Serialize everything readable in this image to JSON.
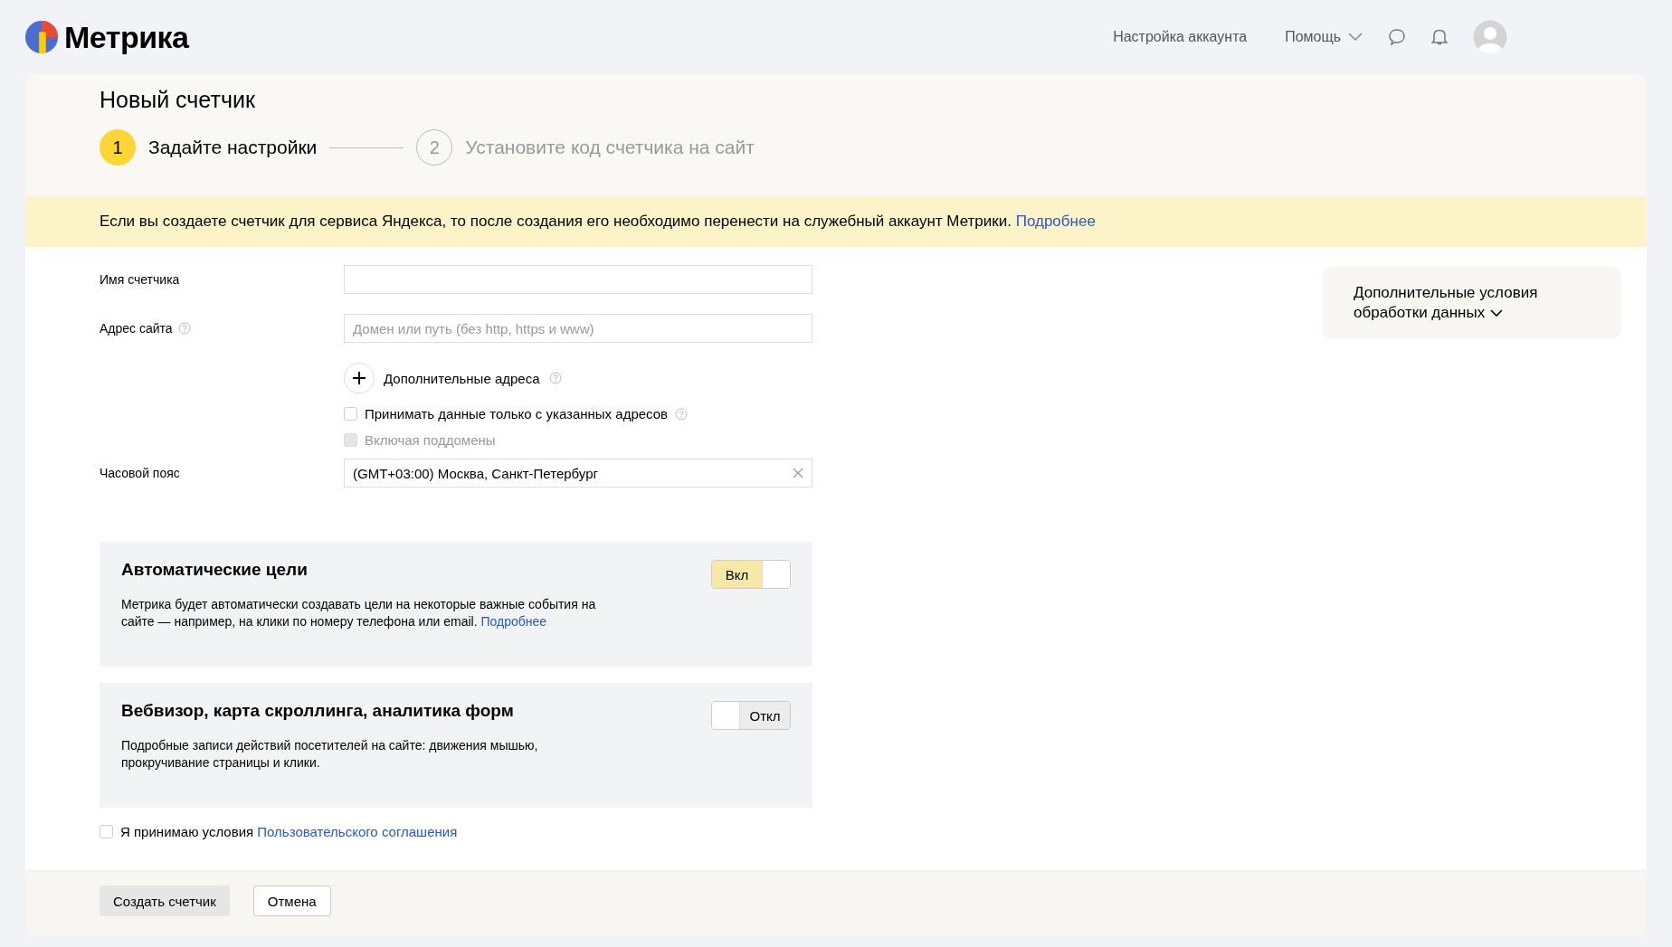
{
  "header": {
    "logo_text": "Метрика",
    "nav": [
      {
        "label": "Настройка аккаунта",
        "kind": "link"
      },
      {
        "label": "Помощь",
        "kind": "dropdown"
      }
    ]
  },
  "page": {
    "title": "Новый счетчик",
    "steps": [
      {
        "number": "1",
        "label": "Задайте настройки",
        "selected": true
      },
      {
        "number": "2",
        "label": "Установите код счетчика на сайт",
        "selected": false
      }
    ],
    "notice": {
      "text": "Если вы создаете счетчик для сервиса Яндекса, то после создания его необходимо перенести на служебный аккаунт Метрики.",
      "link": "Подробнее"
    },
    "fields": [
      {
        "label": "Имя счетчика",
        "help": false
      },
      {
        "label": "Адрес сайта",
        "help": true,
        "placeholder": "Домен или путь (без http, https и www)"
      }
    ],
    "extra_addresses": {
      "label": "Дополнительные адреса",
      "help": true
    },
    "checkboxes": [
      {
        "label": "Принимать данные только с указанных адресов",
        "checked": false,
        "disabled": false,
        "help": true
      },
      {
        "label": "Включая поддомены",
        "checked": false,
        "disabled": true,
        "help": false
      }
    ],
    "timezone": {
      "label": "Часовой пояс",
      "value": "(GMT+03:00) Москва, Санкт-Петербург",
      "clearable": true
    },
    "toggles": [
      {
        "title": "Автоматические цели",
        "description": "Метрика будет автоматически создавать цели на некоторые важные события на сайте — например, на клики по номеру телефона или email.",
        "link": "Подробнее",
        "on": true,
        "label": "Вкл"
      },
      {
        "title": "Вебвизор, карта скроллинга, аналитика форм",
        "description": "Подробные записи действий посетителей на сайте: движения мышью, прокручивание страницы и клики.",
        "on": false,
        "label": "Откл"
      }
    ],
    "agreement": {
      "text": "Я принимаю условия",
      "link": "Пользовательского соглашения",
      "checked": false
    },
    "side_panel": {
      "label": "Дополнительные условия обработки данных"
    },
    "buttons": [
      {
        "label": "Создать счетчик",
        "kind": "primary"
      },
      {
        "label": "Отмена",
        "kind": "secondary"
      }
    ]
  }
}
